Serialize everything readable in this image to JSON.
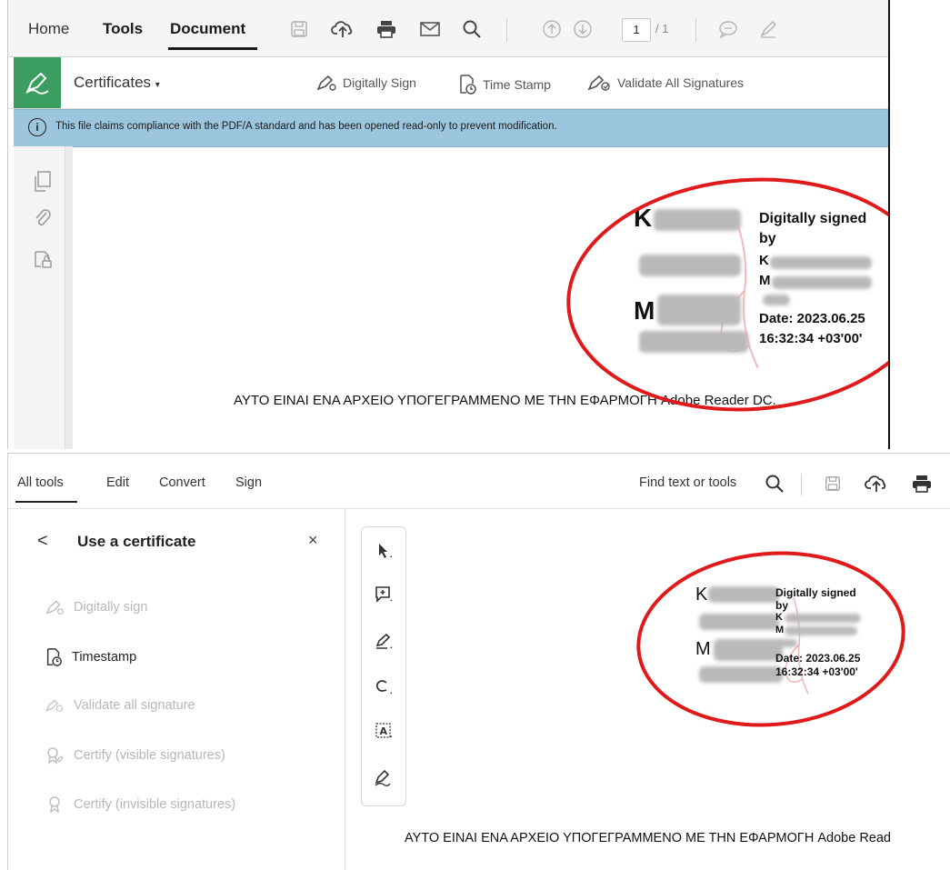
{
  "top": {
    "menu": {
      "home": "Home",
      "tools": "Tools",
      "document": "Document",
      "page_current": "1",
      "page_total": "/ 1"
    },
    "toolbar": {
      "certificates": "Certificates",
      "digitally_sign": "Digitally Sign",
      "time_stamp": "Time Stamp",
      "validate_all": "Validate All Signatures"
    },
    "infobar": {
      "icon": "info-icon",
      "text": "This file claims compliance with the PDF/A standard and has been opened read-only to prevent modification."
    },
    "signature": {
      "name_initial_1": "K",
      "name_initial_2": "M",
      "digitally_signed": "Digitally signed",
      "by": "by",
      "signer_1": "K",
      "signer_2": "M",
      "date": "Date: 2023.06.25",
      "time": "16:32:34 +03'00'"
    },
    "document_text": "ΑΥΤΟ ΕΙΝΑΙ ΕΝΑ ΑΡΧΕΙΟ ΥΠΟΓΕΓΡΑΜΜΕΝΟ ΜΕ ΤΗΝ ΕΦΑΡΜΟΓΗ Adobe Reader DC."
  },
  "bottom": {
    "menu": {
      "all_tools": "All tools",
      "edit": "Edit",
      "convert": "Convert",
      "sign": "Sign",
      "find": "Find text or tools"
    },
    "panel": {
      "back": "<",
      "title": "Use a certificate",
      "close": "×",
      "items": [
        {
          "label": "Digitally sign",
          "enabled": false
        },
        {
          "label": "Timestamp",
          "enabled": true
        },
        {
          "label": "Validate all signature",
          "enabled": false
        },
        {
          "label": "Certify (visible signatures)",
          "enabled": false
        },
        {
          "label": "Certify (invisible signatures)",
          "enabled": false
        }
      ]
    },
    "signature": {
      "name_initial_1": "K",
      "name_initial_2": "M",
      "digitally_signed": "Digitally signed",
      "by": "by",
      "signer_1": "K",
      "signer_2": "M",
      "date": "Date: 2023.06.25",
      "time": "16:32:34 +03'00'"
    },
    "document_text": "ΑΥΤΟ ΕΙΝΑΙ ΕΝΑ ΑΡΧΕΙΟ ΥΠΟΓΕΓΡΑΜΜΕΝΟ ΜΕ ΤΗΝ ΕΦΑΡΜΟΓΗ Adobe Read"
  },
  "colors": {
    "accent_green": "#3b9e60",
    "infobar_blue": "#9cc6de",
    "annotation_red": "#e01a1a"
  }
}
